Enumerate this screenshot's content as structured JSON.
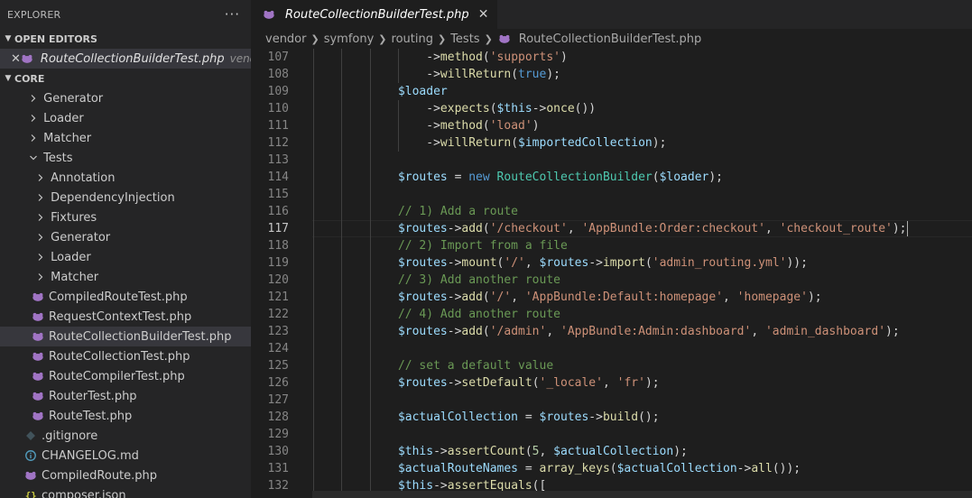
{
  "sidebar": {
    "title": "EXPLORER",
    "more_label": "···",
    "open_editors_label": "OPEN EDITORS",
    "open_editor": {
      "close": "✕",
      "filename": "RouteCollectionBuilderTest.php",
      "path": "vendor..."
    },
    "core_label": "CORE",
    "tree": [
      {
        "label": "Generator",
        "type": "folder",
        "level": 0,
        "expanded": false
      },
      {
        "label": "Loader",
        "type": "folder",
        "level": 0,
        "expanded": false
      },
      {
        "label": "Matcher",
        "type": "folder",
        "level": 0,
        "expanded": false
      },
      {
        "label": "Tests",
        "type": "folder",
        "level": 0,
        "expanded": true
      },
      {
        "label": "Annotation",
        "type": "folder",
        "level": 1,
        "expanded": false
      },
      {
        "label": "DependencyInjection",
        "type": "folder",
        "level": 1,
        "expanded": false
      },
      {
        "label": "Fixtures",
        "type": "folder",
        "level": 1,
        "expanded": false
      },
      {
        "label": "Generator",
        "type": "folder",
        "level": 1,
        "expanded": false
      },
      {
        "label": "Loader",
        "type": "folder",
        "level": 1,
        "expanded": false
      },
      {
        "label": "Matcher",
        "type": "folder",
        "level": 1,
        "expanded": false
      },
      {
        "label": "CompiledRouteTest.php",
        "type": "php",
        "level": 1
      },
      {
        "label": "RequestContextTest.php",
        "type": "php",
        "level": 1
      },
      {
        "label": "RouteCollectionBuilderTest.php",
        "type": "php",
        "level": 1,
        "selected": true
      },
      {
        "label": "RouteCollectionTest.php",
        "type": "php",
        "level": 1
      },
      {
        "label": "RouteCompilerTest.php",
        "type": "php",
        "level": 1
      },
      {
        "label": "RouterTest.php",
        "type": "php",
        "level": 1
      },
      {
        "label": "RouteTest.php",
        "type": "php",
        "level": 1
      },
      {
        "label": ".gitignore",
        "type": "git",
        "level": 0
      },
      {
        "label": "CHANGELOG.md",
        "type": "info",
        "level": 0
      },
      {
        "label": "CompiledRoute.php",
        "type": "php",
        "level": 0
      },
      {
        "label": "composer.json",
        "type": "json",
        "level": 0
      }
    ]
  },
  "tab": {
    "filename": "RouteCollectionBuilderTest.php",
    "close": "✕"
  },
  "breadcrumb": [
    "vendor",
    "symfony",
    "routing",
    "Tests"
  ],
  "breadcrumb_file": "RouteCollectionBuilderTest.php",
  "colors": {
    "php_icon": "#a074c4",
    "info_icon": "#519aba",
    "json_icon": "#cbcb41",
    "git_icon": "#41535b"
  },
  "code": {
    "active_line": 117,
    "lines": [
      {
        "n": 107,
        "indent": 16,
        "tokens": [
          [
            "op",
            "->"
          ],
          [
            "fn",
            "method"
          ],
          [
            "op",
            "("
          ],
          [
            "str",
            "'supports'"
          ],
          [
            "op",
            ")"
          ]
        ]
      },
      {
        "n": 108,
        "indent": 16,
        "tokens": [
          [
            "op",
            "->"
          ],
          [
            "fn",
            "willReturn"
          ],
          [
            "op",
            "("
          ],
          [
            "kw",
            "true"
          ],
          [
            "op",
            ");"
          ]
        ]
      },
      {
        "n": 109,
        "indent": 12,
        "tokens": [
          [
            "var",
            "$loader"
          ]
        ]
      },
      {
        "n": 110,
        "indent": 16,
        "tokens": [
          [
            "op",
            "->"
          ],
          [
            "fn",
            "expects"
          ],
          [
            "op",
            "("
          ],
          [
            "var",
            "$this"
          ],
          [
            "op",
            "->"
          ],
          [
            "fn",
            "once"
          ],
          [
            "op",
            "())"
          ]
        ]
      },
      {
        "n": 111,
        "indent": 16,
        "tokens": [
          [
            "op",
            "->"
          ],
          [
            "fn",
            "method"
          ],
          [
            "op",
            "("
          ],
          [
            "str",
            "'load'"
          ],
          [
            "op",
            ")"
          ]
        ]
      },
      {
        "n": 112,
        "indent": 16,
        "tokens": [
          [
            "op",
            "->"
          ],
          [
            "fn",
            "willReturn"
          ],
          [
            "op",
            "("
          ],
          [
            "var",
            "$importedCollection"
          ],
          [
            "op",
            ");"
          ]
        ]
      },
      {
        "n": 113,
        "indent": 0,
        "tokens": []
      },
      {
        "n": 114,
        "indent": 12,
        "tokens": [
          [
            "var",
            "$routes"
          ],
          [
            "op",
            " = "
          ],
          [
            "kw",
            "new"
          ],
          [
            "op",
            " "
          ],
          [
            "cls",
            "RouteCollectionBuilder"
          ],
          [
            "op",
            "("
          ],
          [
            "var",
            "$loader"
          ],
          [
            "op",
            ");"
          ]
        ]
      },
      {
        "n": 115,
        "indent": 0,
        "tokens": []
      },
      {
        "n": 116,
        "indent": 12,
        "tokens": [
          [
            "cm",
            "// 1) Add a route"
          ]
        ]
      },
      {
        "n": 117,
        "indent": 12,
        "tokens": [
          [
            "var",
            "$routes"
          ],
          [
            "op",
            "->"
          ],
          [
            "fn",
            "add"
          ],
          [
            "op",
            "("
          ],
          [
            "str",
            "'/checkout'"
          ],
          [
            "op",
            ", "
          ],
          [
            "str",
            "'AppBundle:Order:checkout'"
          ],
          [
            "op",
            ", "
          ],
          [
            "str",
            "'checkout_route'"
          ],
          [
            "op",
            ");"
          ]
        ]
      },
      {
        "n": 118,
        "indent": 12,
        "tokens": [
          [
            "cm",
            "// 2) Import from a file"
          ]
        ]
      },
      {
        "n": 119,
        "indent": 12,
        "tokens": [
          [
            "var",
            "$routes"
          ],
          [
            "op",
            "->"
          ],
          [
            "fn",
            "mount"
          ],
          [
            "op",
            "("
          ],
          [
            "str",
            "'/'"
          ],
          [
            "op",
            ", "
          ],
          [
            "var",
            "$routes"
          ],
          [
            "op",
            "->"
          ],
          [
            "fn",
            "import"
          ],
          [
            "op",
            "("
          ],
          [
            "str",
            "'admin_routing.yml'"
          ],
          [
            "op",
            "));"
          ]
        ]
      },
      {
        "n": 120,
        "indent": 12,
        "tokens": [
          [
            "cm",
            "// 3) Add another route"
          ]
        ]
      },
      {
        "n": 121,
        "indent": 12,
        "tokens": [
          [
            "var",
            "$routes"
          ],
          [
            "op",
            "->"
          ],
          [
            "fn",
            "add"
          ],
          [
            "op",
            "("
          ],
          [
            "str",
            "'/'"
          ],
          [
            "op",
            ", "
          ],
          [
            "str",
            "'AppBundle:Default:homepage'"
          ],
          [
            "op",
            ", "
          ],
          [
            "str",
            "'homepage'"
          ],
          [
            "op",
            ");"
          ]
        ]
      },
      {
        "n": 122,
        "indent": 12,
        "tokens": [
          [
            "cm",
            "// 4) Add another route"
          ]
        ]
      },
      {
        "n": 123,
        "indent": 12,
        "tokens": [
          [
            "var",
            "$routes"
          ],
          [
            "op",
            "->"
          ],
          [
            "fn",
            "add"
          ],
          [
            "op",
            "("
          ],
          [
            "str",
            "'/admin'"
          ],
          [
            "op",
            ", "
          ],
          [
            "str",
            "'AppBundle:Admin:dashboard'"
          ],
          [
            "op",
            ", "
          ],
          [
            "str",
            "'admin_dashboard'"
          ],
          [
            "op",
            ");"
          ]
        ]
      },
      {
        "n": 124,
        "indent": 0,
        "tokens": []
      },
      {
        "n": 125,
        "indent": 12,
        "tokens": [
          [
            "cm",
            "// set a default value"
          ]
        ]
      },
      {
        "n": 126,
        "indent": 12,
        "tokens": [
          [
            "var",
            "$routes"
          ],
          [
            "op",
            "->"
          ],
          [
            "fn",
            "setDefault"
          ],
          [
            "op",
            "("
          ],
          [
            "str",
            "'_locale'"
          ],
          [
            "op",
            ", "
          ],
          [
            "str",
            "'fr'"
          ],
          [
            "op",
            ");"
          ]
        ]
      },
      {
        "n": 127,
        "indent": 0,
        "tokens": []
      },
      {
        "n": 128,
        "indent": 12,
        "tokens": [
          [
            "var",
            "$actualCollection"
          ],
          [
            "op",
            " = "
          ],
          [
            "var",
            "$routes"
          ],
          [
            "op",
            "->"
          ],
          [
            "fn",
            "build"
          ],
          [
            "op",
            "();"
          ]
        ]
      },
      {
        "n": 129,
        "indent": 0,
        "tokens": []
      },
      {
        "n": 130,
        "indent": 12,
        "tokens": [
          [
            "var",
            "$this"
          ],
          [
            "op",
            "->"
          ],
          [
            "fn",
            "assertCount"
          ],
          [
            "op",
            "("
          ],
          [
            "num",
            "5"
          ],
          [
            "op",
            ", "
          ],
          [
            "var",
            "$actualCollection"
          ],
          [
            "op",
            ");"
          ]
        ]
      },
      {
        "n": 131,
        "indent": 12,
        "tokens": [
          [
            "var",
            "$actualRouteNames"
          ],
          [
            "op",
            " = "
          ],
          [
            "fn",
            "array_keys"
          ],
          [
            "op",
            "("
          ],
          [
            "var",
            "$actualCollection"
          ],
          [
            "op",
            "->"
          ],
          [
            "fn",
            "all"
          ],
          [
            "op",
            "());"
          ]
        ]
      },
      {
        "n": 132,
        "indent": 12,
        "tokens": [
          [
            "var",
            "$this"
          ],
          [
            "op",
            "->"
          ],
          [
            "fn",
            "assertEquals"
          ],
          [
            "op",
            "(["
          ]
        ]
      }
    ]
  }
}
